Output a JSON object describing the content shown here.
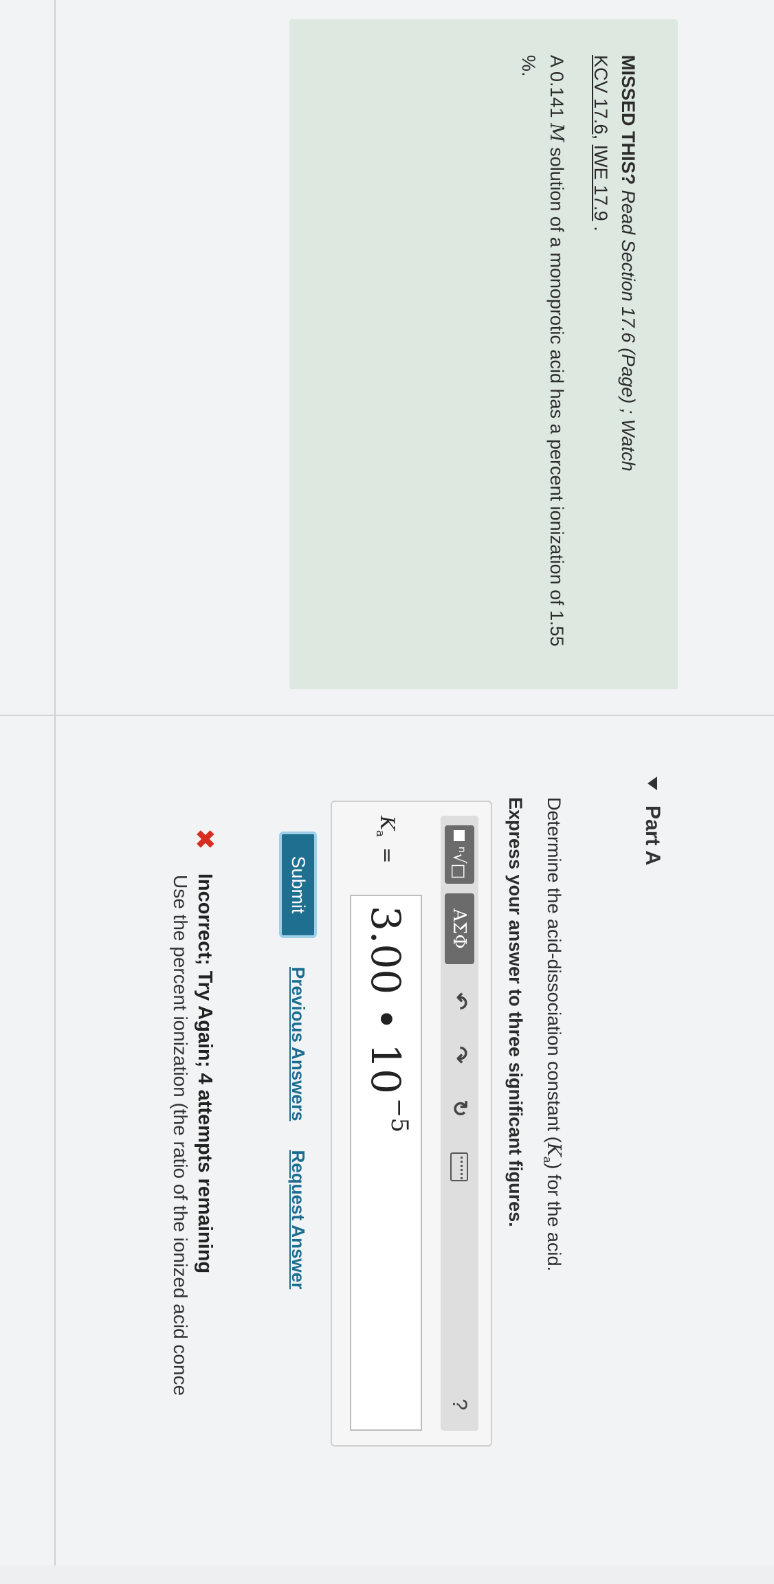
{
  "intro": {
    "missed": "MISSED THIS?",
    "read": "Read Section 17.6 (Page) ; Watch",
    "link_kcv": "KCV 17.6",
    "sep": ", ",
    "link_iwe": "IWE 17.9",
    "period": " .",
    "problem_pre": "A 0.141",
    "problem_unit": "M",
    "problem_mid": "solution of a monoprotic acid has a percent ionization of 1.55 %."
  },
  "part": {
    "label": "Part A"
  },
  "question": {
    "prompt_pre": "Determine the acid-dissociation constant (",
    "prompt_var": "K",
    "prompt_sub": "a",
    "prompt_post": ") for the acid.",
    "instruction": "Express your answer to three significant figures."
  },
  "toolbar": {
    "templates_glyph": "ⁿ√□",
    "greek_label": "ΑΣΦ",
    "undo_glyph": "↶",
    "redo_glyph": "↷",
    "reset_glyph": "↻",
    "help_label": "?"
  },
  "answer": {
    "var": "K",
    "sub": "a",
    "eq": " =",
    "mantissa": "3.00 • 10",
    "exponent": "−5"
  },
  "actions": {
    "submit": "Submit",
    "previous": "Previous Answers",
    "request": "Request Answer"
  },
  "feedback": {
    "title": "Incorrect; Try Again; 4 attempts remaining",
    "hint": "Use the percent ionization (the ratio of the ionized acid conce"
  },
  "colors": {
    "intro_bg": "#dde8e1",
    "submit_bg": "#1f6f90",
    "link": "#1a6d8f",
    "error": "#d62d20"
  }
}
